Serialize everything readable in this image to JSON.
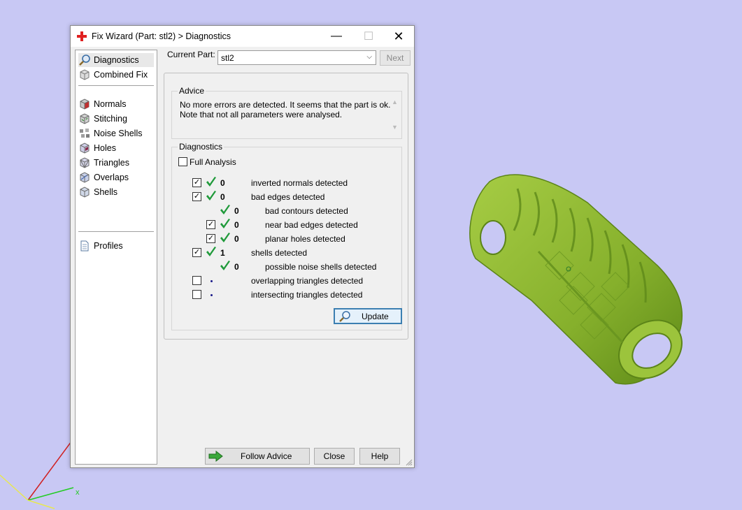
{
  "window": {
    "title": "Fix Wizard (Part: stl2) > Diagnostics",
    "controls": {
      "minimize": "—",
      "maximize": "☐",
      "close": "✕"
    }
  },
  "sidebar": {
    "items": [
      {
        "label": "Diagnostics",
        "icon": "magnifier-icon",
        "selected": true
      },
      {
        "label": "Combined Fix",
        "icon": "cube-icon"
      },
      {
        "label": "Normals",
        "icon": "normals-cube-icon"
      },
      {
        "label": "Stitching",
        "icon": "stitching-cube-icon"
      },
      {
        "label": "Noise Shells",
        "icon": "noise-shells-icon"
      },
      {
        "label": "Holes",
        "icon": "holes-cube-icon"
      },
      {
        "label": "Triangles",
        "icon": "triangles-cube-icon"
      },
      {
        "label": "Overlaps",
        "icon": "overlaps-cube-icon"
      },
      {
        "label": "Shells",
        "icon": "shells-cube-icon"
      },
      {
        "label": "Profiles",
        "icon": "document-icon"
      }
    ]
  },
  "current_part": {
    "label": "Current Part:",
    "value": "stl2"
  },
  "next_label": "Next",
  "advice": {
    "title": "Advice",
    "line1": "No more errors are detected. It seems that the part is ok.",
    "line2": "Note that not all parameters were analysed."
  },
  "diagnostics": {
    "title": "Diagnostics",
    "full_analysis": {
      "label": "Full Analysis",
      "checked": false
    },
    "rows": [
      {
        "checkbox": true,
        "checked": true,
        "status": "ok",
        "count": "0",
        "label": "inverted normals detected",
        "indent": 0
      },
      {
        "checkbox": true,
        "checked": true,
        "status": "ok",
        "count": "0",
        "label": "bad edges detected",
        "indent": 0
      },
      {
        "checkbox": false,
        "checked": false,
        "status": "ok",
        "count": "0",
        "label": "bad contours detected",
        "indent": 1
      },
      {
        "checkbox": true,
        "checked": true,
        "status": "ok",
        "count": "0",
        "label": "near bad edges detected",
        "indent": 1
      },
      {
        "checkbox": true,
        "checked": true,
        "status": "ok",
        "count": "0",
        "label": "planar holes detected",
        "indent": 1
      },
      {
        "checkbox": true,
        "checked": true,
        "status": "ok",
        "count": "1",
        "label": "shells detected",
        "indent": 0
      },
      {
        "checkbox": false,
        "checked": false,
        "status": "ok",
        "count": "0",
        "label": "possible noise shells detected",
        "indent": 1
      },
      {
        "checkbox": true,
        "checked": false,
        "status": "pending",
        "count": "",
        "label": "overlapping triangles detected",
        "indent": 0
      },
      {
        "checkbox": true,
        "checked": false,
        "status": "pending",
        "count": "",
        "label": "intersecting triangles detected",
        "indent": 0
      }
    ],
    "update_label": "Update"
  },
  "footer": {
    "follow_advice": "Follow Advice",
    "close": "Close",
    "help": "Help"
  },
  "viewport": {
    "axis_x_label": "x",
    "model_color": "#8cb832"
  }
}
